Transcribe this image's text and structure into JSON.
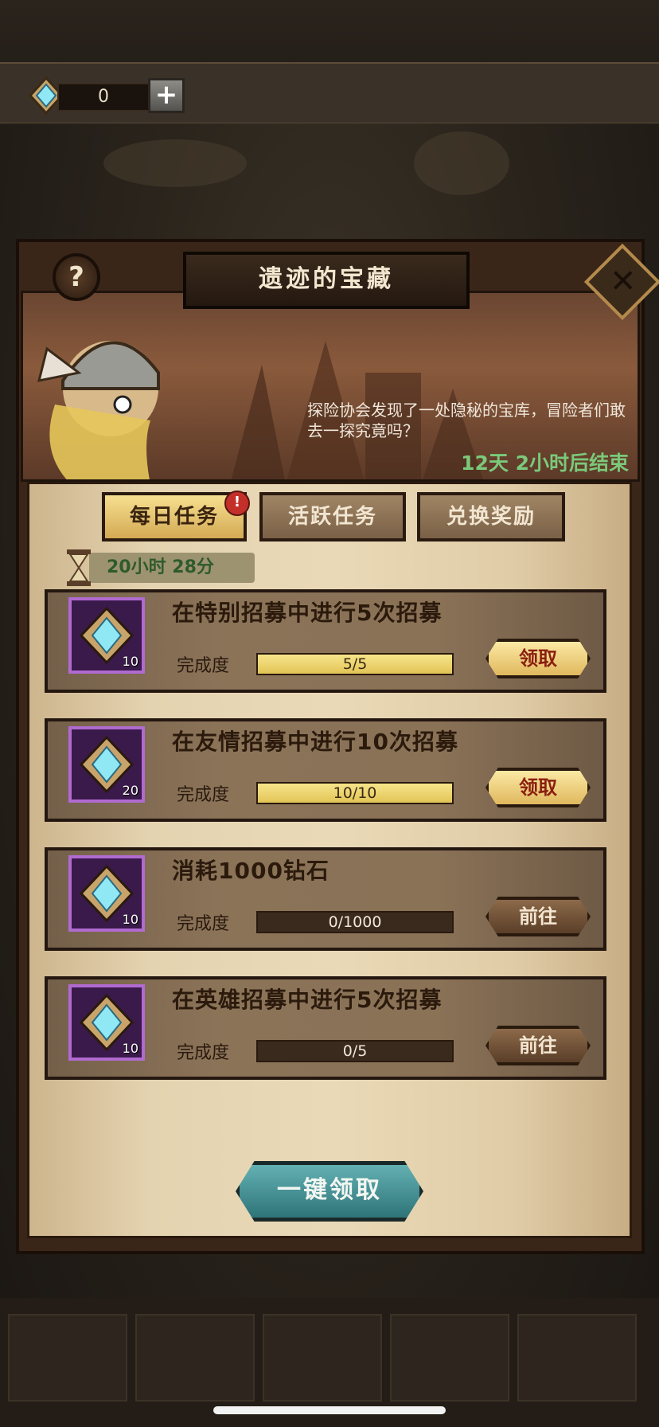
{
  "currency": {
    "amount": "0",
    "icon": "diamond-icon",
    "add_icon": "plus-icon"
  },
  "event": {
    "title": "遗迹的宝藏",
    "description": "探险协会发现了一处隐秘的宝库，冒险者们敢去一探究竟吗？",
    "ends_in": "12天 2小时后结束",
    "help_icon": "question-icon",
    "close_icon": "close-icon"
  },
  "tabs": [
    {
      "label": "每日任务",
      "active": true,
      "alert": "!"
    },
    {
      "label": "活跃任务",
      "active": false
    },
    {
      "label": "兑换奖励",
      "active": false
    }
  ],
  "timer": "20小时 28分",
  "progress_label": "完成度",
  "tasks": [
    {
      "title": "在特别招募中进行5次招募",
      "reward_count": "10",
      "progress": "5/5",
      "ratio": 1.0,
      "action": "领取"
    },
    {
      "title": "在友情招募中进行10次招募",
      "reward_count": "20",
      "progress": "10/10",
      "ratio": 1.0,
      "action": "领取"
    },
    {
      "title": "消耗1000钻石",
      "reward_count": "10",
      "progress": "0/1000",
      "ratio": 0.0,
      "action": "前往"
    },
    {
      "title": "在英雄招募中进行5次招募",
      "reward_count": "10",
      "progress": "0/5",
      "ratio": 0.0,
      "action": "前往"
    }
  ],
  "claim_all_label": "一键领取",
  "colors": {
    "accent_gold": "#e2c456",
    "claim_text": "#8a1e10",
    "timer_green": "#7bc97a",
    "claim_all": "#2e7478"
  }
}
